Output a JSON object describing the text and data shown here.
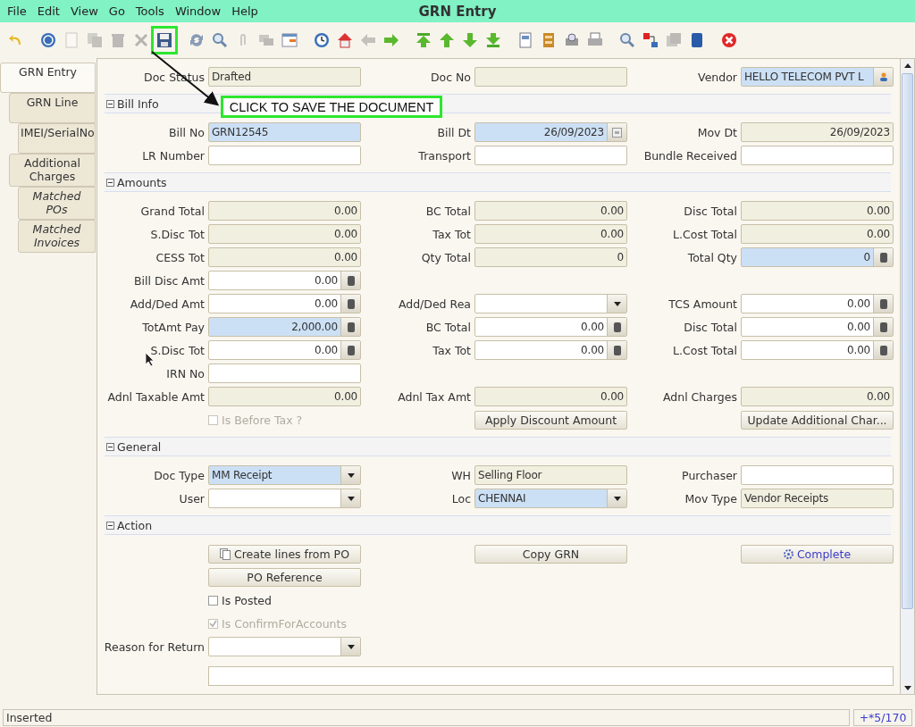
{
  "window": {
    "title": "GRN Entry"
  },
  "menu": [
    "File",
    "Edit",
    "View",
    "Go",
    "Tools",
    "Window",
    "Help"
  ],
  "toolbar": [
    {
      "kind": "undo",
      "disabled": false,
      "highlighted": false
    },
    {
      "kind": "separator"
    },
    {
      "kind": "help",
      "disabled": false,
      "highlighted": false
    },
    {
      "kind": "new",
      "disabled": true,
      "highlighted": false
    },
    {
      "kind": "copy",
      "disabled": true,
      "highlighted": false
    },
    {
      "kind": "delete",
      "disabled": true,
      "highlighted": false
    },
    {
      "kind": "delete-selection",
      "disabled": true,
      "highlighted": false
    },
    {
      "kind": "save",
      "disabled": false,
      "highlighted": true
    },
    {
      "kind": "separator"
    },
    {
      "kind": "refresh",
      "disabled": false,
      "highlighted": false
    },
    {
      "kind": "find",
      "disabled": false,
      "highlighted": false
    },
    {
      "kind": "attach",
      "disabled": true,
      "highlighted": false
    },
    {
      "kind": "chat",
      "disabled": true,
      "highlighted": false
    },
    {
      "kind": "grid",
      "disabled": false,
      "highlighted": false
    },
    {
      "kind": "separator"
    },
    {
      "kind": "history",
      "disabled": false,
      "highlighted": false
    },
    {
      "kind": "home",
      "disabled": false,
      "highlighted": false
    },
    {
      "kind": "back",
      "disabled": true,
      "highlighted": false
    },
    {
      "kind": "forward",
      "disabled": false,
      "highlighted": false
    },
    {
      "kind": "separator"
    },
    {
      "kind": "first",
      "disabled": false,
      "highlighted": false
    },
    {
      "kind": "previous",
      "disabled": false,
      "highlighted": false
    },
    {
      "kind": "next",
      "disabled": false,
      "highlighted": false
    },
    {
      "kind": "last",
      "disabled": false,
      "highlighted": false
    },
    {
      "kind": "separator"
    },
    {
      "kind": "report",
      "disabled": false,
      "highlighted": false
    },
    {
      "kind": "archive",
      "disabled": false,
      "highlighted": false
    },
    {
      "kind": "print-preview",
      "disabled": false,
      "highlighted": false
    },
    {
      "kind": "print",
      "disabled": false,
      "highlighted": false
    },
    {
      "kind": "separator"
    },
    {
      "kind": "zoom-across",
      "disabled": false,
      "highlighted": false
    },
    {
      "kind": "request",
      "disabled": false,
      "highlighted": false
    },
    {
      "kind": "product",
      "disabled": true,
      "highlighted": false
    },
    {
      "kind": "workflow",
      "disabled": false,
      "highlighted": false
    },
    {
      "kind": "separator"
    },
    {
      "kind": "close",
      "disabled": false,
      "highlighted": false
    }
  ],
  "annotation": {
    "text": "CLICK TO SAVE THE DOCUMENT"
  },
  "tabs": [
    {
      "label": "GRN Entry",
      "selected": true,
      "italic": false,
      "children": [
        {
          "label": "GRN Line",
          "selected": false,
          "italic": false,
          "children": [
            {
              "label": "IMEI/SerialNo",
              "selected": false,
              "italic": false
            }
          ]
        },
        {
          "label": "Additional Charges",
          "selected": false,
          "italic": false,
          "children": [
            {
              "label": "Matched POs",
              "selected": false,
              "italic": true
            },
            {
              "label": "Matched Invoices",
              "selected": false,
              "italic": true
            }
          ]
        }
      ]
    }
  ],
  "form": [
    {
      "kind": "row",
      "cells": [
        {
          "kind": "text-field",
          "label": "Doc Status",
          "value": "Drafted",
          "readonly": true,
          "mandatory": false
        },
        {
          "kind": "text-field",
          "label": "Doc No",
          "readonly": true,
          "mandatory": false
        },
        {
          "kind": "search-field",
          "label": "Vendor",
          "value": "HELLO TELECOM PVT L",
          "readonly": false,
          "mandatory": true
        }
      ]
    },
    {
      "kind": "section",
      "title": "Bill Info",
      "expanded": true
    },
    {
      "kind": "row",
      "cells": [
        {
          "kind": "text-field",
          "label": "Bill No",
          "value": "GRN12545",
          "readonly": false,
          "mandatory": true
        },
        {
          "kind": "date-field",
          "label": "Bill Dt",
          "value": "26/09/2023",
          "readonly": false,
          "mandatory": true
        },
        {
          "kind": "date-field",
          "label": "Mov Dt",
          "value": "26/09/2023",
          "readonly": true,
          "mandatory": false
        }
      ]
    },
    {
      "kind": "row",
      "cells": [
        {
          "kind": "text-field",
          "label": "LR Number",
          "readonly": false,
          "mandatory": false
        },
        {
          "kind": "text-field",
          "label": "Transport",
          "readonly": false,
          "mandatory": false
        },
        {
          "kind": "text-field",
          "label": "Bundle Received",
          "readonly": false,
          "mandatory": false
        }
      ]
    },
    {
      "kind": "section",
      "title": "Amounts",
      "expanded": true
    },
    {
      "kind": "row",
      "cells": [
        {
          "kind": "number-field",
          "label": "Grand Total",
          "value": "0.00",
          "readonly": true,
          "mandatory": false
        },
        {
          "kind": "number-field",
          "label": "BC Total",
          "value": "0.00",
          "readonly": true,
          "mandatory": false
        },
        {
          "kind": "number-field",
          "label": "Disc Total",
          "value": "0.00",
          "readonly": true,
          "mandatory": false
        }
      ]
    },
    {
      "kind": "row",
      "cells": [
        {
          "kind": "number-field",
          "label": "S.Disc Tot",
          "value": "0.00",
          "readonly": true,
          "mandatory": false
        },
        {
          "kind": "number-field",
          "label": "Tax Tot",
          "value": "0.00",
          "readonly": true,
          "mandatory": false
        },
        {
          "kind": "number-field",
          "label": "L.Cost Total",
          "value": "0.00",
          "readonly": true,
          "mandatory": false
        }
      ]
    },
    {
      "kind": "row",
      "cells": [
        {
          "kind": "number-field",
          "label": "CESS Tot",
          "value": "0.00",
          "readonly": true,
          "mandatory": false
        },
        {
          "kind": "number-field",
          "label": "Qty Total",
          "value": "0",
          "readonly": true,
          "mandatory": false
        },
        {
          "kind": "number-field",
          "label": "Total Qty",
          "value": "0",
          "readonly": false,
          "mandatory": true
        }
      ]
    },
    {
      "kind": "row",
      "cells": [
        {
          "kind": "number-field",
          "label": "Bill Disc Amt",
          "value": "0.00",
          "readonly": false,
          "mandatory": false
        }
      ]
    },
    {
      "kind": "row",
      "cells": [
        {
          "kind": "number-field",
          "label": "Add/Ded Amt",
          "value": "0.00",
          "readonly": false,
          "mandatory": false
        },
        {
          "kind": "combo-field",
          "label": "Add/Ded Rea",
          "readonly": false,
          "mandatory": false
        },
        {
          "kind": "number-field",
          "label": "TCS Amount",
          "value": "0.00",
          "readonly": false,
          "mandatory": false
        }
      ]
    },
    {
      "kind": "row",
      "cells": [
        {
          "kind": "number-field",
          "label": "TotAmt Pay",
          "value": "2,000.00",
          "readonly": false,
          "mandatory": true
        },
        {
          "kind": "number-field",
          "label": "BC Total",
          "value": "0.00",
          "readonly": false,
          "mandatory": false
        },
        {
          "kind": "number-field",
          "label": "Disc Total",
          "value": "0.00",
          "readonly": false,
          "mandatory": false
        }
      ]
    },
    {
      "kind": "row",
      "cells": [
        {
          "kind": "number-field",
          "label": "S.Disc Tot",
          "value": "0.00",
          "readonly": false,
          "mandatory": false
        },
        {
          "kind": "number-field",
          "label": "Tax Tot",
          "value": "0.00",
          "readonly": false,
          "mandatory": false
        },
        {
          "kind": "number-field",
          "label": "L.Cost Total",
          "value": "0.00",
          "readonly": false,
          "mandatory": false
        }
      ]
    },
    {
      "kind": "row",
      "cells": [
        {
          "kind": "text-field",
          "label": "IRN No",
          "readonly": false,
          "mandatory": false
        }
      ]
    },
    {
      "kind": "row",
      "cells": [
        {
          "kind": "number-field",
          "label": "Adnl Taxable Amt",
          "value": "0.00",
          "readonly": true,
          "mandatory": false
        },
        {
          "kind": "number-field",
          "label": "Adnl Tax Amt",
          "value": "0.00",
          "readonly": true,
          "mandatory": false
        },
        {
          "kind": "number-field",
          "label": "Adnl Charges",
          "value": "0.00",
          "readonly": true,
          "mandatory": false
        }
      ]
    },
    {
      "kind": "row",
      "cells": [
        {
          "kind": "checkbox",
          "label": "Is Before Tax ?",
          "checked": false,
          "disabled": true
        },
        {
          "kind": "button",
          "label": "Apply Discount Amount"
        },
        {
          "kind": "button",
          "label": "Update Additional Char..."
        }
      ]
    },
    {
      "kind": "section",
      "title": "General",
      "expanded": true
    },
    {
      "kind": "row",
      "cells": [
        {
          "kind": "combo-field",
          "label": "Doc Type",
          "value": "MM Receipt",
          "readonly": false,
          "mandatory": true
        },
        {
          "kind": "text-field",
          "label": "WH",
          "value": "Selling Floor",
          "readonly": true,
          "mandatory": false
        },
        {
          "kind": "text-field",
          "label": "Purchaser",
          "readonly": false,
          "mandatory": false
        }
      ]
    },
    {
      "kind": "row",
      "cells": [
        {
          "kind": "combo-field",
          "label": "User",
          "readonly": false,
          "mandatory": false
        },
        {
          "kind": "combo-field",
          "label": "Loc",
          "value": "CHENNAI",
          "readonly": false,
          "mandatory": true
        },
        {
          "kind": "text-field",
          "label": "Mov Type",
          "value": "Vendor Receipts",
          "readonly": true,
          "mandatory": false
        }
      ]
    },
    {
      "kind": "section",
      "title": "Action",
      "expanded": true
    },
    {
      "kind": "row",
      "cells": [
        {
          "kind": "document-button",
          "label": "Create lines from PO"
        },
        {
          "kind": "button",
          "label": "Copy GRN"
        },
        {
          "kind": "process-button",
          "label": "Complete"
        }
      ]
    },
    {
      "kind": "row",
      "cells": [
        {
          "kind": "button",
          "label": "PO Reference"
        }
      ]
    },
    {
      "kind": "row",
      "cells": [
        {
          "kind": "checkbox",
          "label": "Is Posted",
          "checked": false,
          "disabled": false
        }
      ]
    },
    {
      "kind": "row",
      "cells": [
        {
          "kind": "checkbox",
          "label": "Is ConfirmForAccounts",
          "checked": true,
          "disabled": true
        }
      ]
    },
    {
      "kind": "row",
      "cells": [
        {
          "kind": "combo-field",
          "label": "Reason for Return",
          "readonly": false,
          "mandatory": false
        }
      ]
    },
    {
      "kind": "memo"
    }
  ],
  "status_bar": {
    "message": "Inserted",
    "record": "+*5/170"
  }
}
